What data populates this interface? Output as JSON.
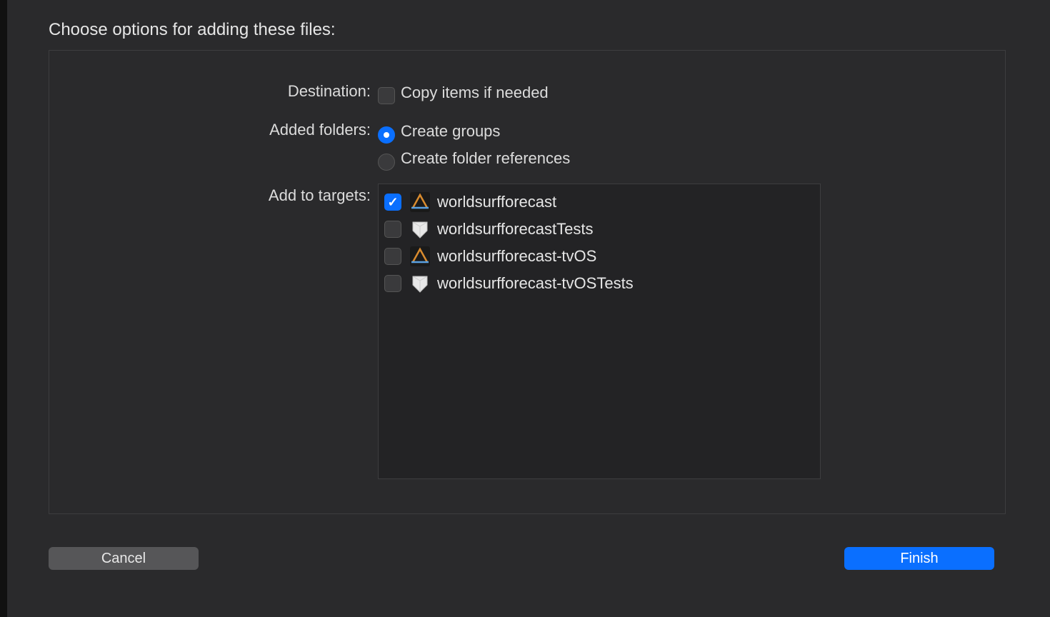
{
  "title": "Choose options for adding these files:",
  "labels": {
    "destination": "Destination:",
    "added_folders": "Added folders:",
    "add_targets": "Add to targets:"
  },
  "destination": {
    "copy_items_label": "Copy items if needed",
    "copy_items_checked": false
  },
  "folders": {
    "create_groups_label": "Create groups",
    "create_refs_label": "Create folder references",
    "selected": "groups"
  },
  "targets": [
    {
      "name": "worldsurfforecast",
      "checked": true,
      "icon": "app"
    },
    {
      "name": "worldsurfforecastTests",
      "checked": false,
      "icon": "test"
    },
    {
      "name": "worldsurfforecast-tvOS",
      "checked": false,
      "icon": "app"
    },
    {
      "name": "worldsurfforecast-tvOSTests",
      "checked": false,
      "icon": "test"
    }
  ],
  "buttons": {
    "cancel": "Cancel",
    "finish": "Finish"
  }
}
